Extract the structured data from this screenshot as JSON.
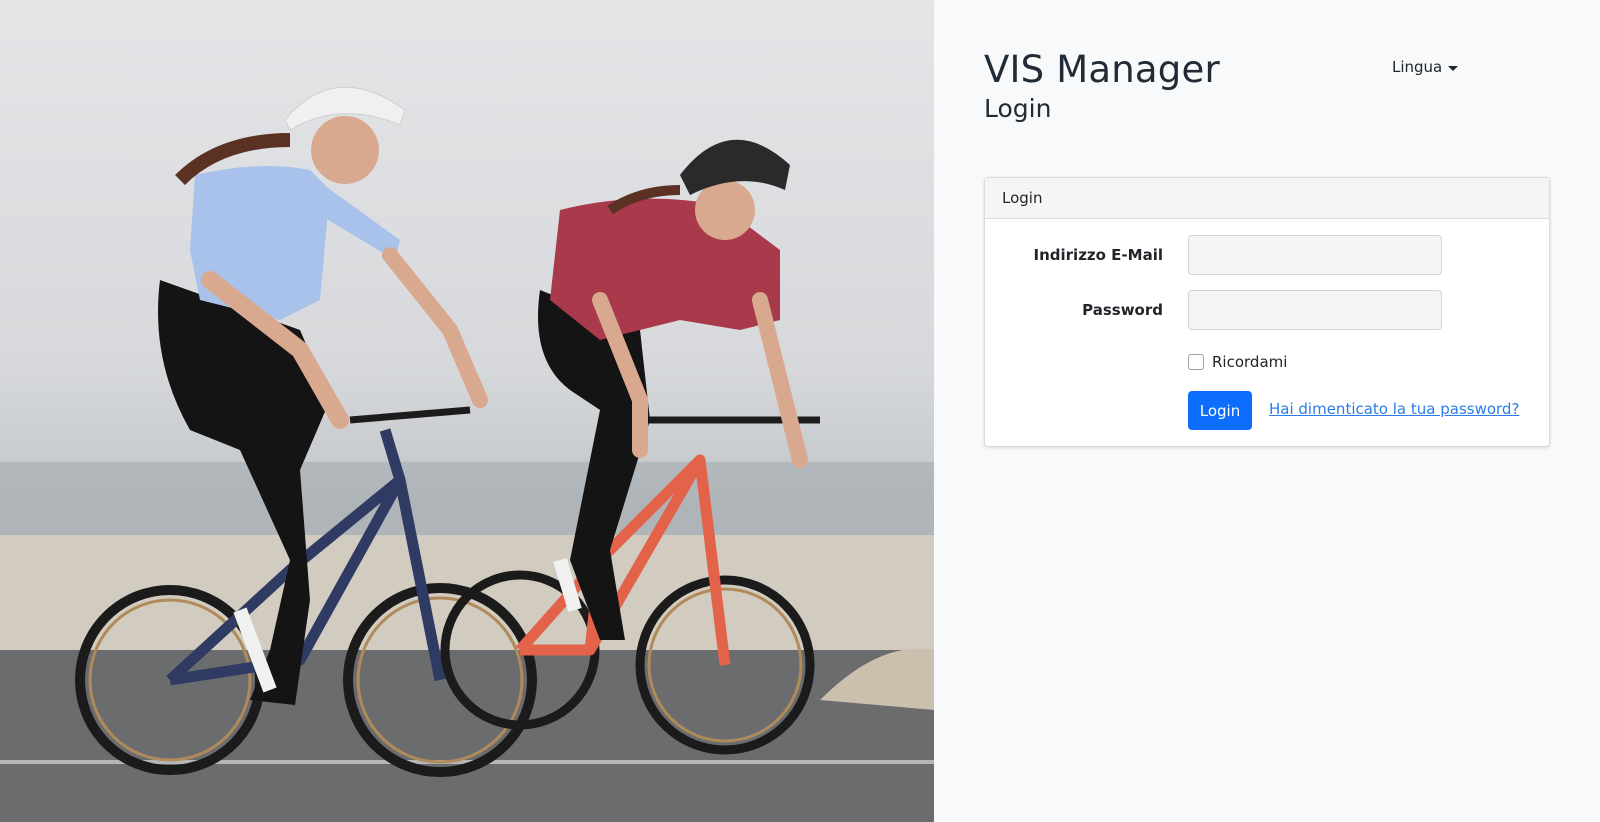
{
  "header": {
    "app_title": "VIS Manager",
    "page_subtitle": "Login",
    "language_dropdown": "Lingua"
  },
  "login_card": {
    "title": "Login",
    "email_label": "Indirizzo E-Mail",
    "email_value": "",
    "password_label": "Password",
    "password_value": "",
    "remember_label": "Ricordami",
    "remember_checked": false,
    "submit_label": "Login",
    "forgot_link": "Hai dimenticato la tua password?"
  },
  "colors": {
    "primary": "#0d6efd",
    "link": "#2b7de9",
    "background": "#f8f9fa"
  },
  "photo": {
    "description_icon": "cyclists-photo"
  }
}
